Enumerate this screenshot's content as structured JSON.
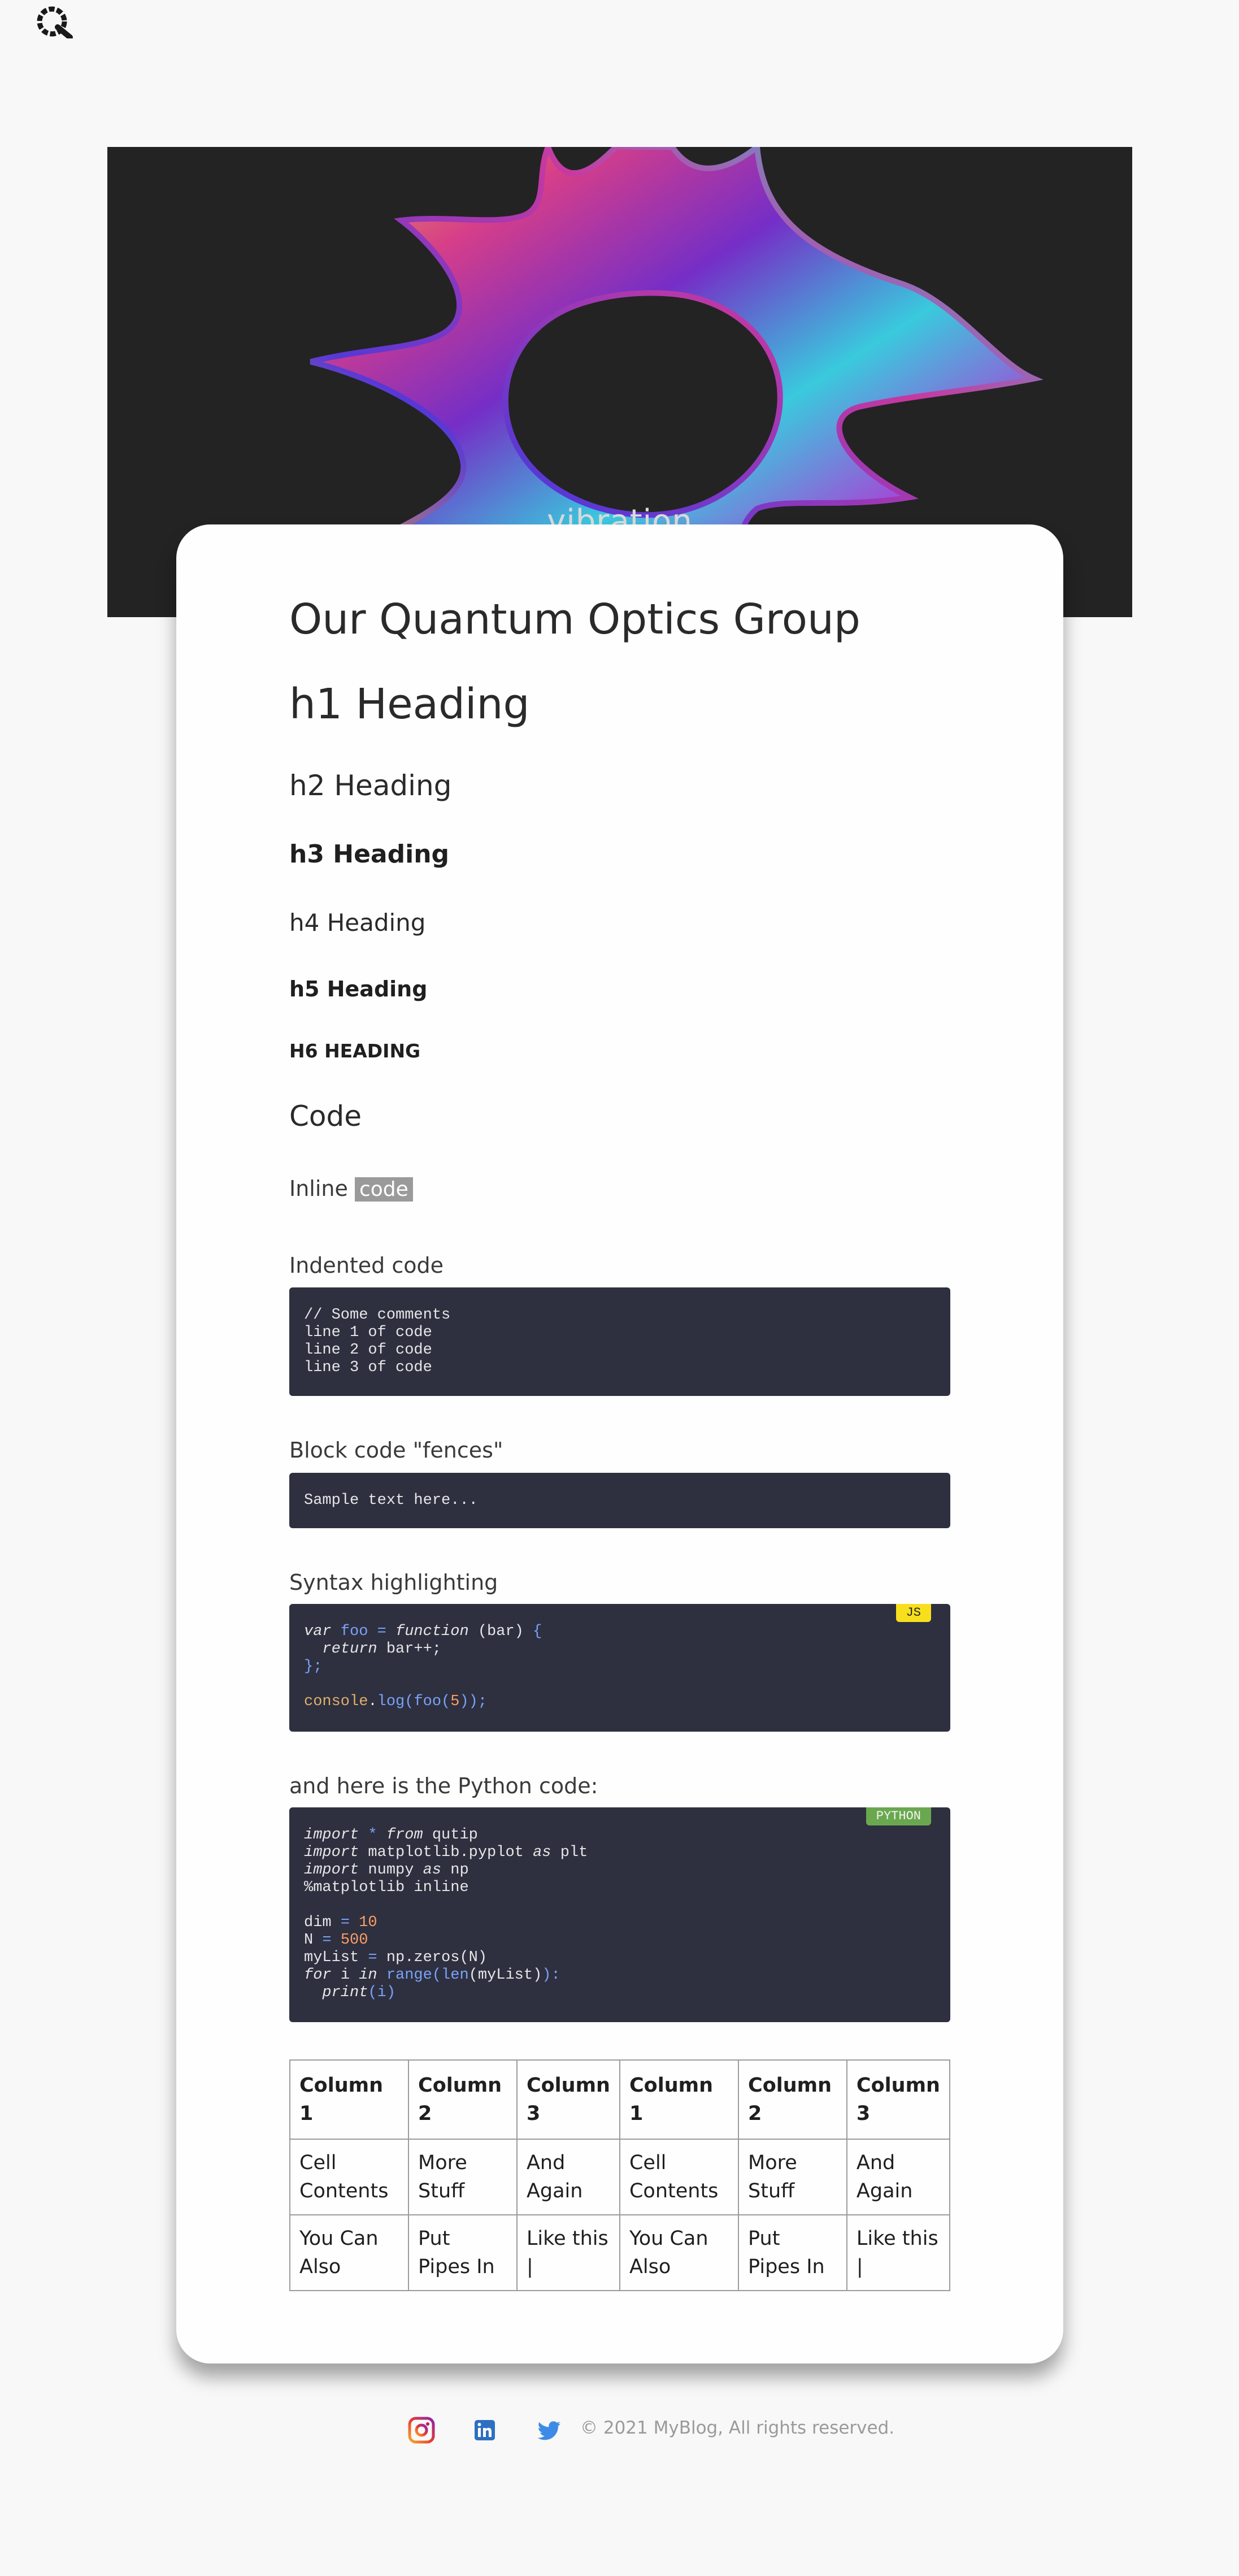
{
  "header": {
    "logo_icon": "quantum-q-logo-icon"
  },
  "hero": {
    "word": "vibration",
    "background_color": "#232323"
  },
  "article": {
    "title": "Our Quantum Optics Group",
    "h1": "h1 Heading",
    "h2": "h2 Heading",
    "h3": "h3 Heading",
    "h4": "h4 Heading",
    "h5": "h5 Heading",
    "h6": "h6 Heading",
    "code_heading": "Code",
    "inline_label": "Inline",
    "inline_code": "code",
    "indented_label": "Indented code",
    "indented_code": "// Some comments\nline 1 of code\nline 2 of code\nline 3 of code",
    "fences_label": "Block code \"fences\"",
    "fences_code": "Sample text here...",
    "syntax_label": "Syntax highlighting",
    "js_badge": "JS",
    "js_badge_color": "#f7df1e",
    "python_label": "and here is the Python code:",
    "python_badge": "PYTHON",
    "python_badge_color": "#6aa84f",
    "code_background": "#2e3040"
  },
  "js_code": {
    "l1_kw1": "var",
    "l1_name": "foo",
    "l1_eq": "=",
    "l1_kw2": "function",
    "l1_args": "(bar)",
    "l1_brace": "{",
    "l2_kw": "return",
    "l2_rest": "bar++;",
    "l3": "};",
    "l5_obj": "console",
    "l5_dot": ".",
    "l5_fn": "log",
    "l5_open": "(",
    "l5_call": "foo",
    "l5_open2": "(",
    "l5_num": "5",
    "l5_close": "));"
  },
  "py_code": {
    "l1_kw1": "import",
    "l1_star": "*",
    "l1_kw2": "from",
    "l1_mod": "qutip",
    "l2_kw1": "import",
    "l2_mod": "matplotlib.pyplot",
    "l2_kw2": "as",
    "l2_alias": "plt",
    "l3_kw1": "import",
    "l3_mod": "numpy",
    "l3_kw2": "as",
    "l3_alias": "np",
    "l4": "%matplotlib inline",
    "l6_var": "dim",
    "l6_eq": "=",
    "l6_num": "10",
    "l7_var": "N",
    "l7_eq": "=",
    "l7_num": "500",
    "l8_var": "myList",
    "l8_eq": "=",
    "l8_rest": "np.zeros(N)",
    "l9_kw1": "for",
    "l9_var": "i",
    "l9_kw2": "in",
    "l9_fn1": "range",
    "l9_p1": "(",
    "l9_fn2": "len",
    "l9_p2": "(myList)",
    "l9_end": "):",
    "l10_kw": "print",
    "l10_rest": "(i)"
  },
  "table": {
    "headers": [
      "Column 1",
      "Column 2",
      "Column 3",
      "Column 1",
      "Column 2",
      "Column 3"
    ],
    "rows": [
      [
        "Cell Contents",
        "More Stuff",
        "And Again",
        "Cell Contents",
        "More Stuff",
        "And Again"
      ],
      [
        "You Can Also",
        "Put Pipes In",
        "Like this |",
        "You Can Also",
        "Put Pipes In",
        "Like this |"
      ]
    ]
  },
  "footer": {
    "instagram_icon": "instagram-icon",
    "linkedin_icon": "linkedin-icon",
    "twitter_icon": "twitter-icon",
    "copyright": "© 2021 MyBlog, All rights reserved."
  }
}
